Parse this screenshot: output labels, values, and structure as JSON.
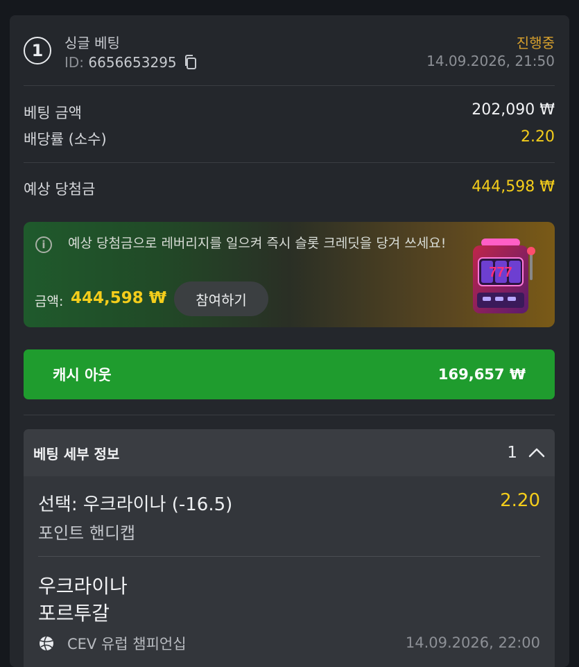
{
  "header": {
    "number": "1",
    "title": "싱글 베팅",
    "id_label": "ID:",
    "id_value": "6656653295",
    "status": "진행중",
    "datetime": "14.09.2026, 21:50"
  },
  "summary": {
    "stake_label": "베팅 금액",
    "stake_value": "202,090 ₩",
    "odds_label": "배당률 (소수)",
    "odds_value": "2.20",
    "payout_label": "예상 당첨금",
    "payout_value": "444,598 ₩"
  },
  "promo": {
    "message": "예상 당첨금으로 레버리지를 일으켜 즉시 슬롯 크레딧을 당겨 쓰세요!",
    "amount_label": "금액:",
    "amount_value": "444,598 ₩",
    "join_label": "참여하기",
    "slot_text": "777"
  },
  "cashout": {
    "label": "캐시 아웃",
    "value": "169,657 ₩"
  },
  "details": {
    "title": "베팅 세부 정보",
    "count": "1",
    "selection": "선택: 우크라이나 (-16.5)",
    "selection_odds": "2.20",
    "market": "포인트 핸디캡",
    "team1": "우크라이나",
    "team2": "포르투갈",
    "league": "CEV 유럽 챔피언십",
    "match_time": "14.09.2026, 22:00"
  },
  "icons": {
    "copy": "copy-icon",
    "info": "info-icon",
    "chevron": "chevron-up-icon",
    "sport": "volleyball-icon"
  },
  "colors": {
    "accent_yellow": "#f4cd1b",
    "status_orange": "#d8a12d",
    "cashout_green": "#1f9c2e"
  }
}
